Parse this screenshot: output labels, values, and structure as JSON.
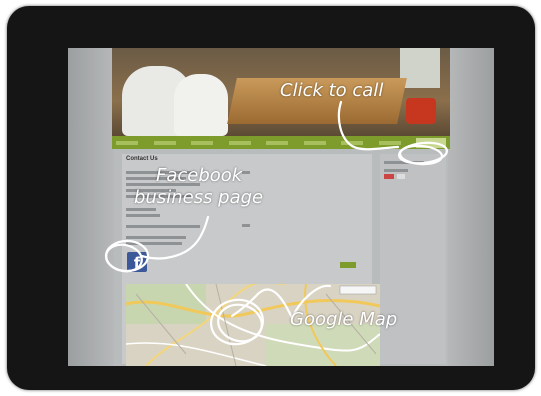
{
  "annotations": {
    "click_to_call": "Click to call",
    "facebook_line1": "Facebook",
    "facebook_line2": "business page",
    "google_map": "Google Map"
  },
  "page": {
    "title": "Contact Us",
    "facebook_icon_letter": "f"
  },
  "colors": {
    "nav_bar": "#7e9c2c",
    "facebook_badge": "#3b5998",
    "annotation": "#ffffff",
    "device_bezel": "#151515"
  },
  "icons": [
    "facebook-icon"
  ]
}
